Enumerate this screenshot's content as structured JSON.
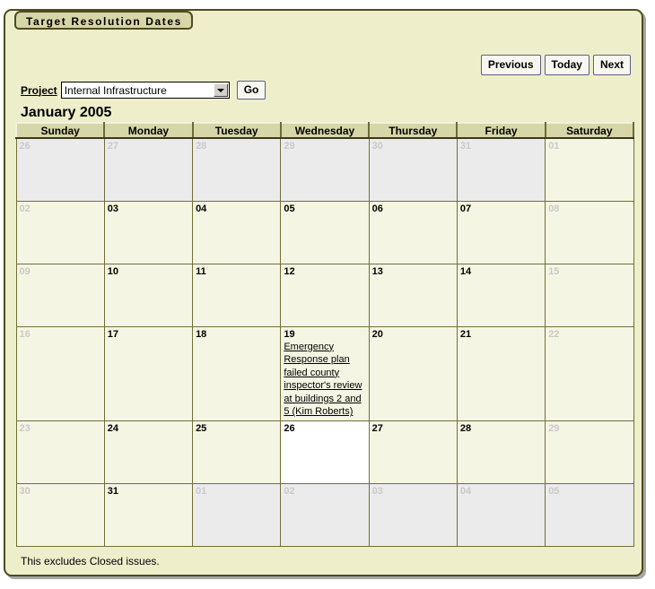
{
  "panel": {
    "tab_title": "Target Resolution Dates",
    "footnote": "This excludes Closed issues."
  },
  "nav": {
    "previous_label": "Previous",
    "today_label": "Today",
    "next_label": "Next"
  },
  "project": {
    "label": "Project",
    "selected": "Internal Infrastructure",
    "go_label": "Go"
  },
  "calendar": {
    "month_title": "January 2005",
    "weekday_headers": [
      "Sunday",
      "Monday",
      "Tuesday",
      "Wednesday",
      "Thursday",
      "Friday",
      "Saturday"
    ],
    "weeks": [
      [
        {
          "num": "26",
          "state": "out",
          "dim": true,
          "events": []
        },
        {
          "num": "27",
          "state": "out",
          "dim": true,
          "events": []
        },
        {
          "num": "28",
          "state": "out",
          "dim": true,
          "events": []
        },
        {
          "num": "29",
          "state": "out",
          "dim": true,
          "events": []
        },
        {
          "num": "30",
          "state": "out",
          "dim": true,
          "events": []
        },
        {
          "num": "31",
          "state": "out",
          "dim": true,
          "events": []
        },
        {
          "num": "01",
          "state": "in",
          "dim": true,
          "events": []
        }
      ],
      [
        {
          "num": "02",
          "state": "in",
          "dim": true,
          "events": []
        },
        {
          "num": "03",
          "state": "in",
          "dim": false,
          "events": []
        },
        {
          "num": "04",
          "state": "in",
          "dim": false,
          "events": []
        },
        {
          "num": "05",
          "state": "in",
          "dim": false,
          "events": []
        },
        {
          "num": "06",
          "state": "in",
          "dim": false,
          "events": []
        },
        {
          "num": "07",
          "state": "in",
          "dim": false,
          "events": []
        },
        {
          "num": "08",
          "state": "in",
          "dim": true,
          "events": []
        }
      ],
      [
        {
          "num": "09",
          "state": "in",
          "dim": true,
          "events": []
        },
        {
          "num": "10",
          "state": "in",
          "dim": false,
          "events": []
        },
        {
          "num": "11",
          "state": "in",
          "dim": false,
          "events": []
        },
        {
          "num": "12",
          "state": "in",
          "dim": false,
          "events": []
        },
        {
          "num": "13",
          "state": "in",
          "dim": false,
          "events": []
        },
        {
          "num": "14",
          "state": "in",
          "dim": false,
          "events": []
        },
        {
          "num": "15",
          "state": "in",
          "dim": true,
          "events": []
        }
      ],
      [
        {
          "num": "16",
          "state": "in",
          "dim": true,
          "events": []
        },
        {
          "num": "17",
          "state": "in",
          "dim": false,
          "events": []
        },
        {
          "num": "18",
          "state": "in",
          "dim": false,
          "events": []
        },
        {
          "num": "19",
          "state": "in",
          "dim": false,
          "events": [
            "Emergency Response plan failed county inspector's review at buildings 2 and 5 (Kim Roberts)"
          ]
        },
        {
          "num": "20",
          "state": "in",
          "dim": false,
          "events": []
        },
        {
          "num": "21",
          "state": "in",
          "dim": false,
          "events": []
        },
        {
          "num": "22",
          "state": "in",
          "dim": true,
          "events": []
        }
      ],
      [
        {
          "num": "23",
          "state": "in",
          "dim": true,
          "events": []
        },
        {
          "num": "24",
          "state": "in",
          "dim": false,
          "events": []
        },
        {
          "num": "25",
          "state": "in",
          "dim": false,
          "events": []
        },
        {
          "num": "26",
          "state": "today",
          "dim": false,
          "events": []
        },
        {
          "num": "27",
          "state": "in",
          "dim": false,
          "events": []
        },
        {
          "num": "28",
          "state": "in",
          "dim": false,
          "events": []
        },
        {
          "num": "29",
          "state": "in",
          "dim": true,
          "events": []
        }
      ],
      [
        {
          "num": "30",
          "state": "in",
          "dim": true,
          "events": []
        },
        {
          "num": "31",
          "state": "in",
          "dim": false,
          "events": []
        },
        {
          "num": "01",
          "state": "out",
          "dim": true,
          "events": []
        },
        {
          "num": "02",
          "state": "out",
          "dim": true,
          "events": []
        },
        {
          "num": "03",
          "state": "out",
          "dim": true,
          "events": []
        },
        {
          "num": "04",
          "state": "out",
          "dim": true,
          "events": []
        },
        {
          "num": "05",
          "state": "out",
          "dim": true,
          "events": []
        }
      ]
    ]
  },
  "colors": {
    "panel_bg": "#eeeecb",
    "panel_border": "#4c4c1e",
    "tab_bg": "#d6d6a8",
    "header_bg": "#d6d6a8",
    "cell_in_month": "#f5f5e3",
    "cell_out_month": "#ebebeb",
    "cell_today": "#ffffff",
    "grid_line": "#6f6f38",
    "dim_text": "#c9c9c9"
  }
}
